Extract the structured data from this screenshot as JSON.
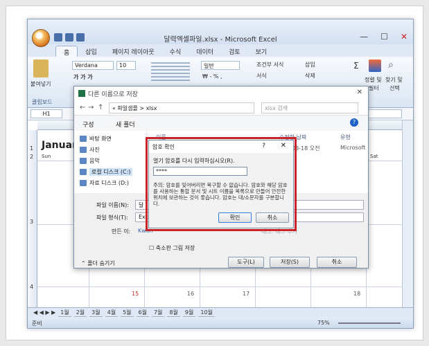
{
  "window": {
    "title": "달력엑셀파일.xlsx - Microsoft Excel"
  },
  "ribbon": {
    "tabs": [
      "홈",
      "삽입",
      "페이지 레이아웃",
      "수식",
      "데이터",
      "검토",
      "보기"
    ],
    "font_name": "Verdana",
    "font_size": "10",
    "paste_label": "붙여넣기",
    "clipboard_label": "클립보드",
    "number_format": "일반",
    "cond_format": "조건부 서식",
    "format_label": "서식",
    "insert_label": "삽입",
    "delete_label": "삭제",
    "sort_label": "정렬 및",
    "find_label": "찾기 및",
    "filter_label": "필터",
    "select_label": "선택"
  },
  "sheet": {
    "cell_ref": "H1",
    "calendar_title": "Januar",
    "dow_sun": "Sun",
    "dow_sat": "Sat",
    "tab_items": [
      "1월",
      "2월",
      "3월",
      "4월",
      "5월",
      "6월",
      "7월",
      "8월",
      "9월",
      "10월"
    ],
    "status_ready": "준비",
    "zoom": "75%"
  },
  "save_as": {
    "title": "다른 이름으로 저장",
    "breadcrumb": "« 파일샘플 > xlsx",
    "search_placeholder": "xlsx 검색",
    "organize": "구성",
    "new_folder": "새 폴더",
    "nav": [
      "바탕 화면",
      "사진",
      "음악",
      "로컬 디스크 (C:)",
      "자료 디스크 (D:)"
    ],
    "col_name": "이름",
    "col_modified": "수정한 날짜",
    "col_type": "유형",
    "file_date": "7-03-18 오전",
    "file_type": "Microsoft",
    "filename_label": "파일 이름(N):",
    "filename_value": "달",
    "filetype_label": "파일 형식(T):",
    "filetype_value": "Exce",
    "author_label": "만든 이:",
    "author_value": "Kwon",
    "tags_value": "태그: 태그 추가",
    "thumbnail_label": "축소판 그림 저장",
    "hide_folders": "폴더 숨기기",
    "tools": "도구(L)",
    "save": "저장(S)",
    "cancel": "취소"
  },
  "password_dialog": {
    "title": "암호 확인",
    "prompt": "열기 암호를 다시 입력하십시오(R).",
    "value": "****",
    "note": "주의: 암호를 잊어버리면 복구할 수 없습니다. 암호와 해당 암호를 사용하는 통합 문서 및 시트 이름을 목록으로 만들어 안전한 위치에 보관하는 것이 좋습니다. 암호는 대/소문자를 구분합니다.",
    "ok": "확인",
    "cancel": "취소"
  },
  "colors": {
    "highlight": "#c9232a",
    "ribbon": "#dfe8f4"
  }
}
